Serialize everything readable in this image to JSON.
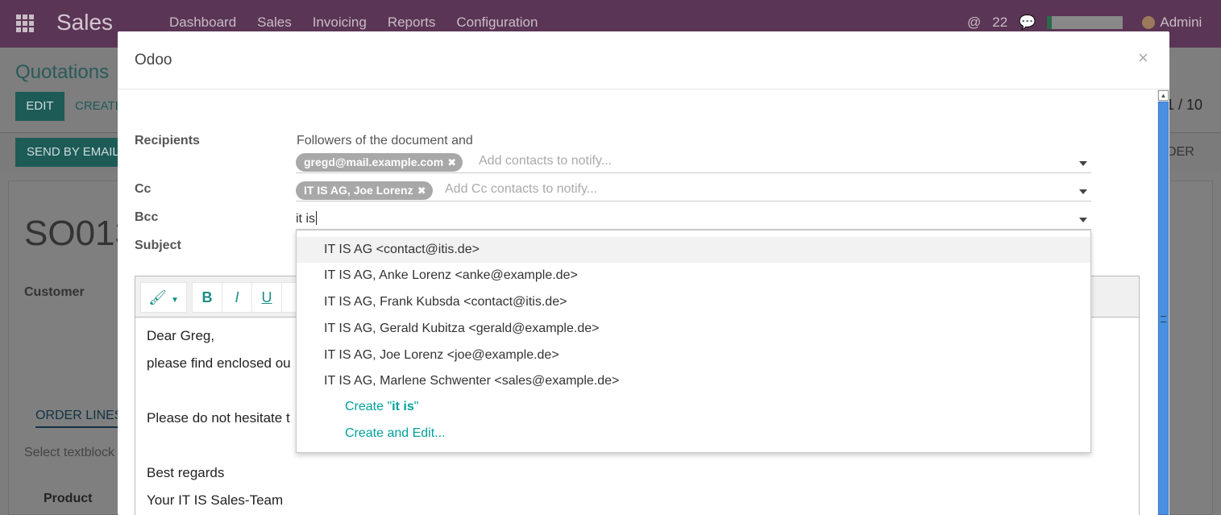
{
  "background": {
    "app_title": "Sales",
    "nav": [
      "Dashboard",
      "Sales",
      "Invoicing",
      "Reports",
      "Configuration"
    ],
    "message_count": "22",
    "user_name": "Admini",
    "breadcrumb": "Quotations",
    "edit_label": "EDIT",
    "create_label": "CREATE",
    "pager": "1 / 10",
    "send_email_label": "SEND BY EMAIL",
    "order_label": "DER",
    "record_name": "SO013",
    "customer_label": "Customer",
    "order_lines_tab": "ORDER LINES",
    "select_textblock": "Select textblock",
    "product_header": "Product"
  },
  "modal": {
    "title": "Odoo",
    "close_glyph": "×",
    "recipients_label": "Recipients",
    "recipients_text": "Followers of the document and",
    "recipient_tags": [
      "gregd@mail.example.com"
    ],
    "recipients_placeholder": "Add contacts to notify...",
    "cc_label": "Cc",
    "cc_tags": [
      "IT IS AG, Joe Lorenz"
    ],
    "cc_placeholder": "Add Cc contacts to notify...",
    "bcc_label": "Bcc",
    "bcc_value": "it is",
    "subject_label": "Subject"
  },
  "dropdown": {
    "items": [
      "IT IS AG <contact@itis.de>",
      "IT IS AG, Anke Lorenz <anke@example.de>",
      "IT IS AG, Frank Kubsda <contact@itis.de>",
      "IT IS AG, Gerald Kubitza <gerald@example.de>",
      "IT IS AG, Joe Lorenz <joe@example.de>",
      "IT IS AG, Marlene Schwenter <sales@example.de>"
    ],
    "create_prefix": "Create \"",
    "create_term": "it is",
    "create_suffix": "\"",
    "create_edit": "Create and Edit..."
  },
  "editor": {
    "toolbar": {
      "style": "🖌",
      "bold": "B",
      "italic": "I",
      "underline": "U"
    },
    "lines": [
      "Dear Greg,",
      "please find enclosed ou",
      "",
      "Please do not hesitate t",
      "",
      "Best regards",
      "Your IT IS Sales-Team"
    ]
  },
  "colors": {
    "brand": "#5b3555",
    "accent": "#00a09d",
    "tag": "#a8a8a8"
  }
}
